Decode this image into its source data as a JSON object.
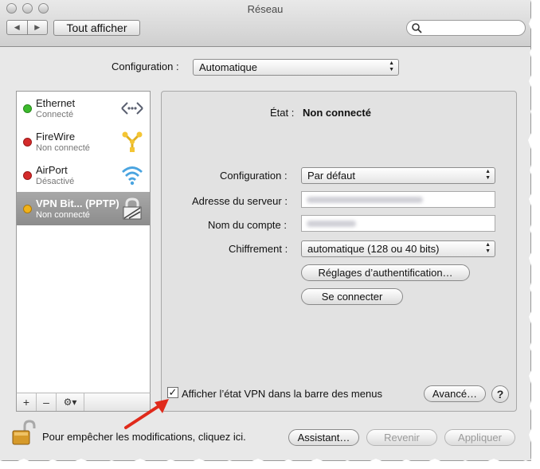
{
  "window": {
    "title": "Réseau"
  },
  "toolbar": {
    "back": "◀",
    "forward": "▶",
    "show_all": "Tout afficher",
    "search_placeholder": ""
  },
  "location": {
    "label": "Configuration :",
    "value": "Automatique"
  },
  "services": [
    {
      "name": "Ethernet",
      "status": "Connecté",
      "dot_color": "#3cba2c",
      "icon": "ethernet-icon"
    },
    {
      "name": "FireWire",
      "status": "Non connecté",
      "dot_color": "#d42a2a",
      "icon": "firewire-icon"
    },
    {
      "name": "AirPort",
      "status": "Désactivé",
      "dot_color": "#d42a2a",
      "icon": "airport-icon"
    },
    {
      "name": "VPN Bit... (PPTP)",
      "status": "Non connecté",
      "dot_color": "#f0b21a",
      "icon": "lock-icon"
    }
  ],
  "sidebar_controls": {
    "add": "+",
    "remove": "–",
    "gear": "⚙︎▾"
  },
  "detail": {
    "state_label": "État :",
    "state_value": "Non connecté",
    "config_label": "Configuration :",
    "config_value": "Par défaut",
    "server_label": "Adresse du serveur :",
    "account_label": "Nom du compte :",
    "encryption_label": "Chiffrement :",
    "encryption_value": "automatique (128 ou 40 bits)",
    "auth_button": "Réglages d’authentification…",
    "connect_button": "Se connecter"
  },
  "footer": {
    "show_vpn_label": "Afficher l’état VPN dans la barre des menus",
    "show_vpn_checked": true,
    "advanced_button": "Avancé…",
    "help": "?",
    "lock_text": "Pour empêcher les modifications, cliquez ici.",
    "assistant_button": "Assistant…",
    "revert_button": "Revenir",
    "apply_button": "Appliquer"
  },
  "colors": {
    "annotation_arrow": "#e02a1b"
  }
}
